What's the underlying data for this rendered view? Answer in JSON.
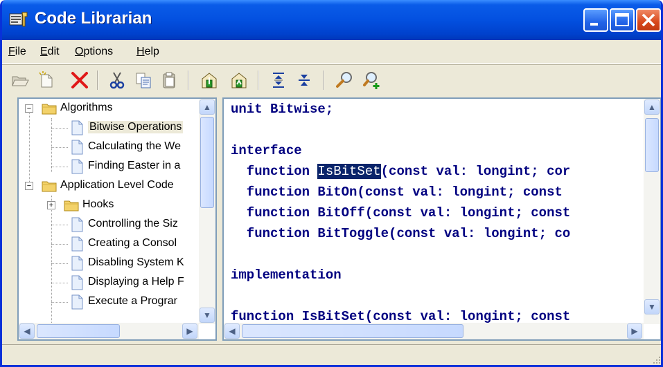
{
  "window": {
    "title": "Code Librarian"
  },
  "menu": [
    {
      "label": "File",
      "acc": "F",
      "rest": "ile"
    },
    {
      "label": "Edit",
      "acc": "E",
      "rest": "dit"
    },
    {
      "label": "Options",
      "acc": "O",
      "rest": "ptions"
    },
    {
      "label": "Help",
      "acc": "H",
      "rest": "elp"
    }
  ],
  "toolbar": {
    "icons": [
      "open-folder-icon",
      "new-item-icon",
      "delete-icon",
      "cut-icon",
      "copy-icon",
      "paste-icon",
      "import-icon",
      "export-icon",
      "expand-all-icon",
      "collapse-all-icon",
      "find-icon",
      "find-next-icon"
    ]
  },
  "tree": {
    "nodes": [
      {
        "label": "Algorithms",
        "type": "folder",
        "expander": "−",
        "level": 0
      },
      {
        "label": "Bitwise Operations",
        "type": "doc",
        "level": 1,
        "selected": true
      },
      {
        "label": "Calculating the We",
        "type": "doc",
        "level": 1
      },
      {
        "label": "Finding Easter in a",
        "type": "doc",
        "level": 1
      },
      {
        "label": "Application Level Code",
        "type": "folder",
        "expander": "−",
        "level": 0
      },
      {
        "label": "Hooks",
        "type": "folder",
        "expander": "+",
        "level": 1
      },
      {
        "label": "Controlling the Siz",
        "type": "doc",
        "level": 1
      },
      {
        "label": "Creating a Consol",
        "type": "doc",
        "level": 1
      },
      {
        "label": "Disabling System K",
        "type": "doc",
        "level": 1
      },
      {
        "label": "Displaying a Help F",
        "type": "doc",
        "level": 1
      },
      {
        "label": "Execute a Prograr",
        "type": "doc",
        "level": 1
      }
    ]
  },
  "code": {
    "lines": [
      [
        {
          "t": "unit Bitwise;",
          "c": "kw"
        }
      ],
      [],
      [
        {
          "t": "interface",
          "c": "kw"
        }
      ],
      [
        {
          "t": "  function ",
          "c": "kw"
        },
        {
          "t": "IsBitSet",
          "c": "hl"
        },
        {
          "t": "(const val: longint; cor",
          "c": "kw"
        }
      ],
      [
        {
          "t": "  function BitOn(const val: longint; const",
          "c": "kw"
        }
      ],
      [
        {
          "t": "  function BitOff(const val: longint; const",
          "c": "kw"
        }
      ],
      [
        {
          "t": "  function BitToggle(const val: longint; co",
          "c": "kw"
        }
      ],
      [],
      [
        {
          "t": "implementation",
          "c": "kw"
        }
      ],
      [],
      [
        {
          "t": "function IsBitSet(const val: longint; const",
          "c": "kw"
        }
      ]
    ]
  },
  "colors": {
    "titlebar": "#0350e0",
    "selection": "#0a246a",
    "keyword": "#000080",
    "frame": "#ece9d8"
  }
}
